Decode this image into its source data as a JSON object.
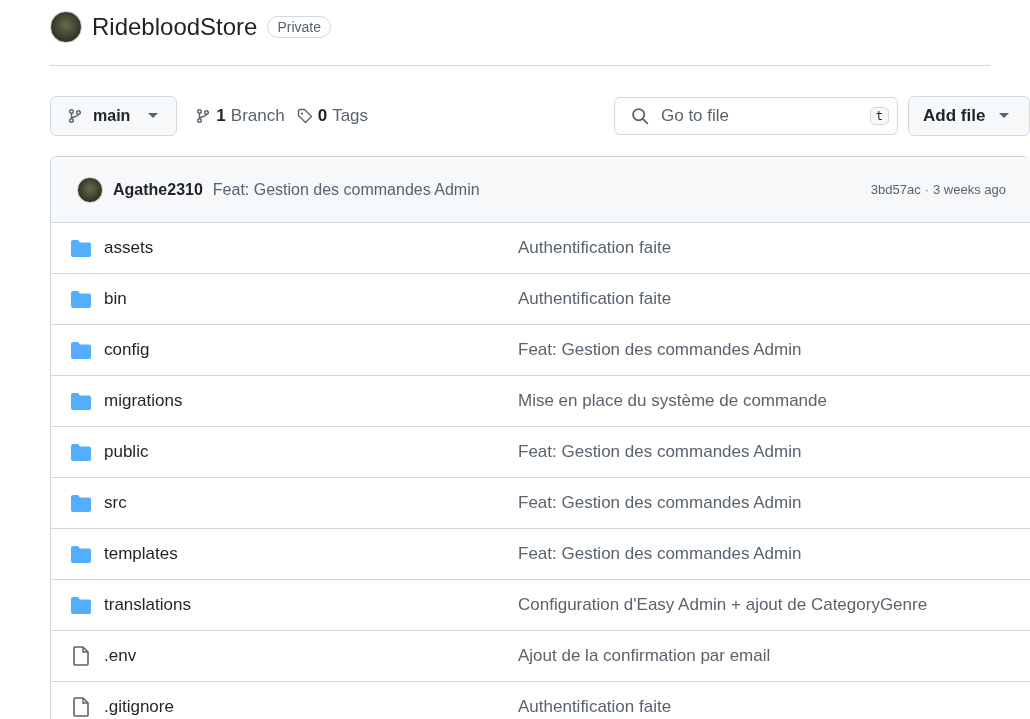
{
  "repo": {
    "name": "RidebloodStore",
    "visibility": "Private"
  },
  "toolbar": {
    "branch": "main",
    "branches": {
      "count": "1",
      "label": "Branch"
    },
    "tags": {
      "count": "0",
      "label": "Tags"
    },
    "search": {
      "placeholder": "Go to file",
      "shortcut": "t"
    },
    "add_file": "Add file"
  },
  "commit": {
    "author": "Agathe2310",
    "message": "Feat: Gestion des commandes Admin",
    "hash": "3bd57ac",
    "separator": "·",
    "time": "3 weeks ago"
  },
  "files": [
    {
      "kind": "folder",
      "name": "assets",
      "message": "Authentification faite"
    },
    {
      "kind": "folder",
      "name": "bin",
      "message": "Authentification faite"
    },
    {
      "kind": "folder",
      "name": "config",
      "message": "Feat: Gestion des commandes Admin"
    },
    {
      "kind": "folder",
      "name": "migrations",
      "message": "Mise en place du système de commande"
    },
    {
      "kind": "folder",
      "name": "public",
      "message": "Feat: Gestion des commandes Admin"
    },
    {
      "kind": "folder",
      "name": "src",
      "message": "Feat: Gestion des commandes Admin"
    },
    {
      "kind": "folder",
      "name": "templates",
      "message": "Feat: Gestion des commandes Admin"
    },
    {
      "kind": "folder",
      "name": "translations",
      "message": "Configuration d'Easy Admin + ajout de CategoryGenre"
    },
    {
      "kind": "file",
      "name": ".env",
      "message": "Ajout de la confirmation par email"
    },
    {
      "kind": "file",
      "name": ".gitignore",
      "message": "Authentification faite"
    }
  ]
}
